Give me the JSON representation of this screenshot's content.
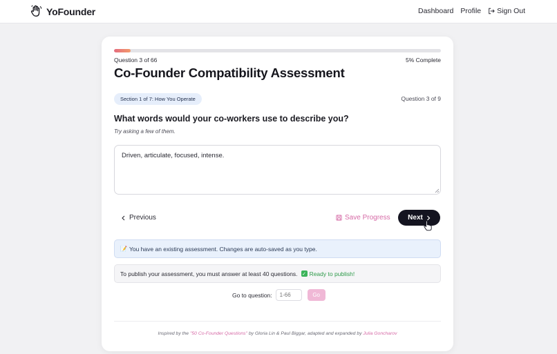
{
  "brand": {
    "name": "YoFounder"
  },
  "nav": {
    "dashboard": "Dashboard",
    "profile": "Profile",
    "sign_out": "Sign Out"
  },
  "progress": {
    "label": "Question 3 of 66",
    "percent_text": "5% Complete",
    "fraction": 0.05
  },
  "assessment": {
    "title": "Co-Founder Compatibility Assessment"
  },
  "section": {
    "badge": "Section 1 of 7: How You Operate",
    "question_counter": "Question 3 of 9"
  },
  "question": {
    "text": "What words would your co-workers use to describe you?",
    "hint": "Try asking a few of them.",
    "answer": "Driven, articulate, focused, intense."
  },
  "actions": {
    "previous": "Previous",
    "save": "Save Progress",
    "next": "Next"
  },
  "notices": {
    "autosave": "You have an existing assessment. Changes are auto-saved as you type.",
    "publish": "To publish your assessment, you must answer at least 40 questions.",
    "ready": "Ready to publish!"
  },
  "goto": {
    "label": "Go to question:",
    "placeholder": "1-66",
    "button": "Go"
  },
  "footer": {
    "prefix": "Inspired by the ",
    "source": "\"50 Co-Founder Questions\"",
    "middle": " by Gloria Lin & Paul Biggar, adapted and expanded by ",
    "author": "Julia Goncharov"
  },
  "colors": {
    "accent_pink": "#d66aa6",
    "dark_button": "#141420",
    "progress_start": "#e46b7e",
    "progress_end": "#f39a6b",
    "success": "#2e9a4a"
  }
}
